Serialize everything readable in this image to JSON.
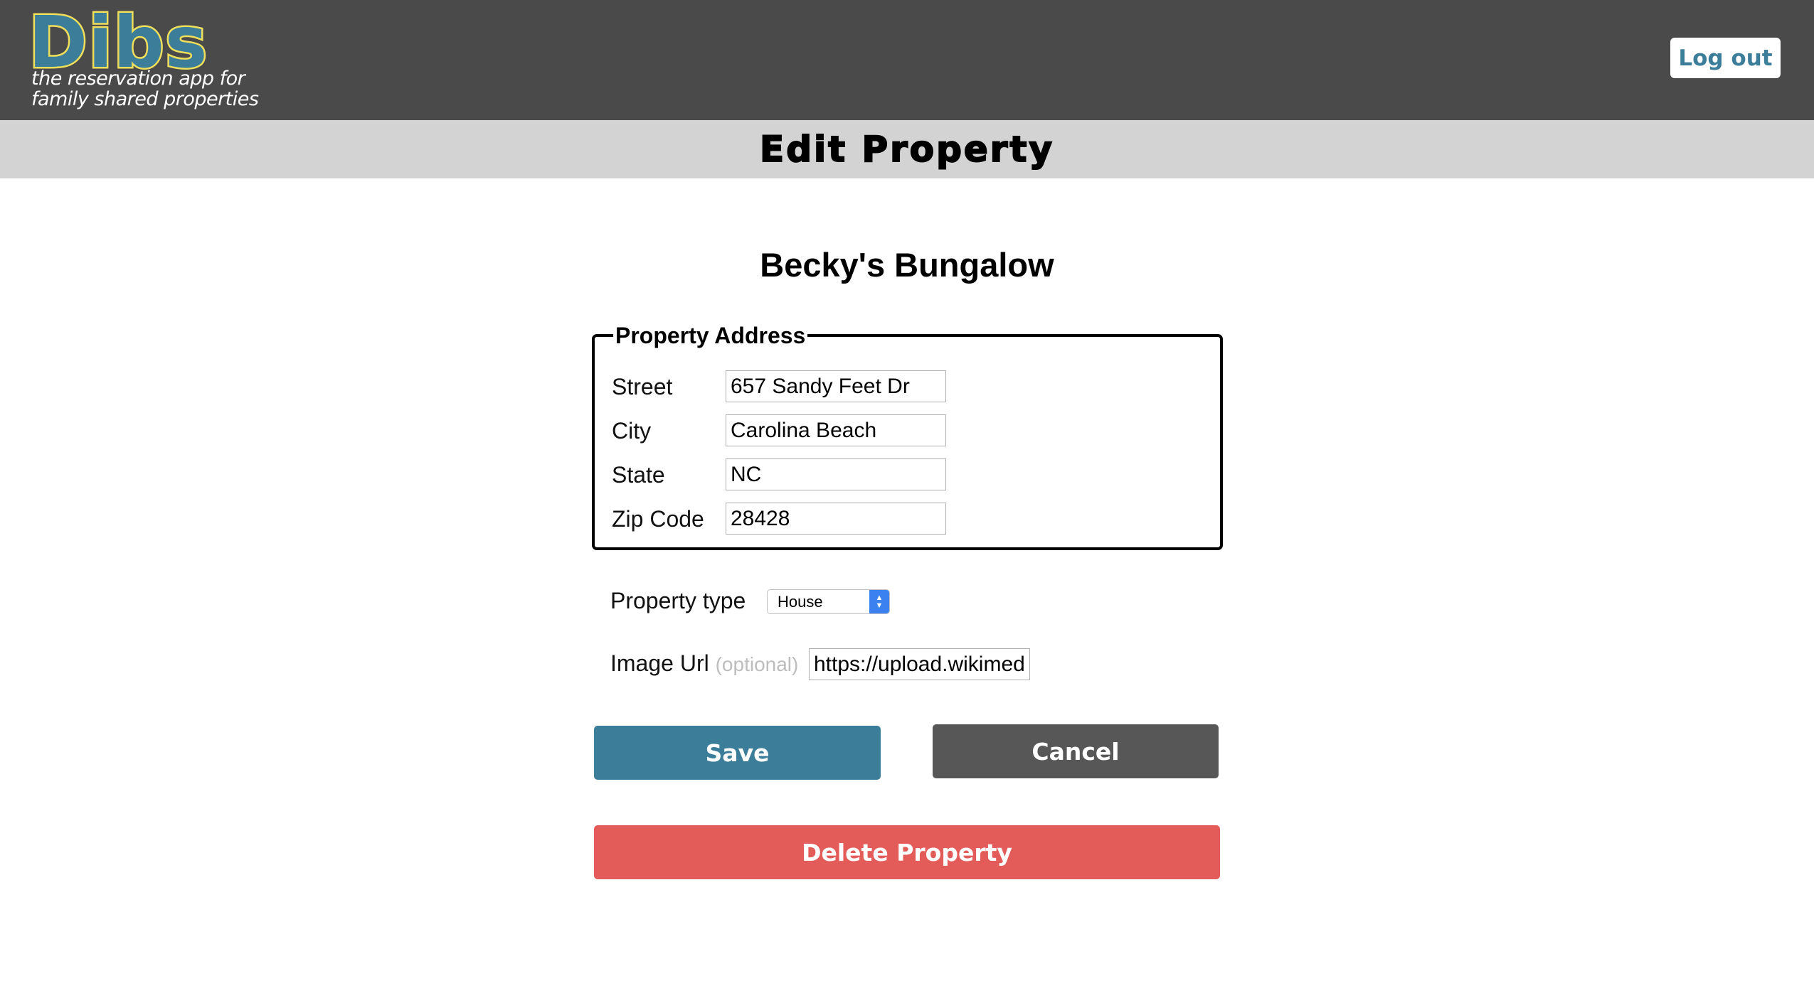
{
  "header": {
    "logo_text": "Dibs",
    "tagline_line1": "the reservation app for",
    "tagline_line2": "family shared properties",
    "logout_label": "Log out",
    "colors": {
      "header_bg": "#4a4a4a",
      "brand_blue": "#3c7d99",
      "brand_yellow": "#f0df5a"
    }
  },
  "subbar": {
    "title": "Edit Property"
  },
  "property": {
    "name": "Becky's Bungalow"
  },
  "address": {
    "legend": "Property Address",
    "fields": [
      {
        "label": "Street",
        "value": "657 Sandy Feet Dr"
      },
      {
        "label": "City",
        "value": "Carolina Beach"
      },
      {
        "label": "State",
        "value": "NC"
      },
      {
        "label": "Zip Code",
        "value": "28428"
      }
    ]
  },
  "property_type": {
    "label": "Property type",
    "selected": "House",
    "icon": "chevron-updown-icon"
  },
  "image_url": {
    "label": "Image Url",
    "optional_note": "(optional)",
    "value": "https://upload.wikimed"
  },
  "actions": {
    "save_label": "Save",
    "cancel_label": "Cancel",
    "delete_label": "Delete Property",
    "colors": {
      "save": "#3c7d99",
      "cancel": "#575757",
      "delete": "#e35c5a"
    }
  }
}
